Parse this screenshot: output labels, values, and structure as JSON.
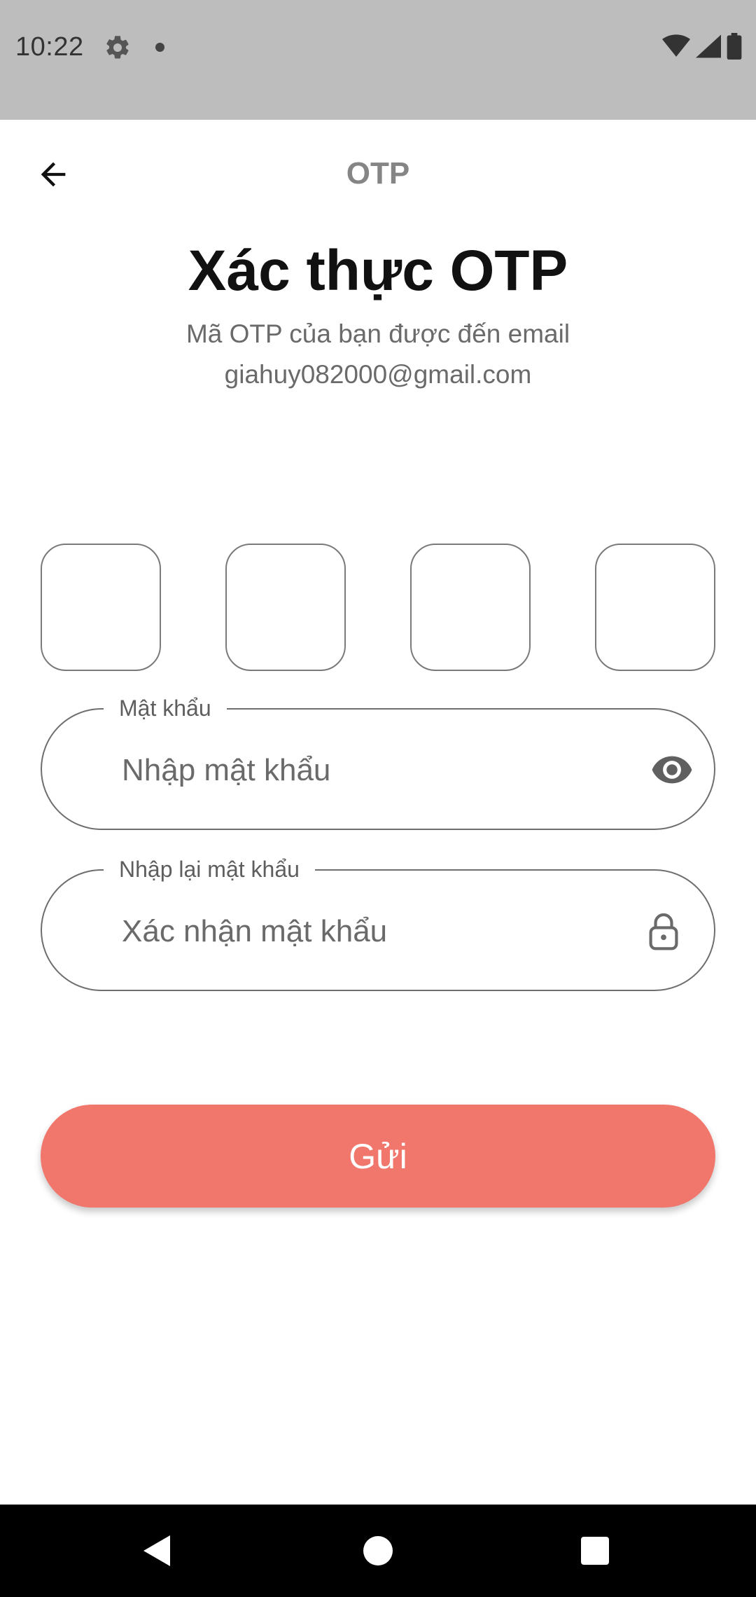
{
  "status_bar": {
    "time": "10:22",
    "icons": [
      "settings-gear-icon",
      "notification-dot-icon",
      "wifi-icon",
      "cellular-signal-icon",
      "battery-icon"
    ]
  },
  "app_bar": {
    "title": "OTP",
    "back_icon": "arrow-back-icon"
  },
  "main": {
    "heading": "Xác thực OTP",
    "subtitle_line1": "Mã OTP của bạn được đến email",
    "subtitle_line2": "giahuy082000@gmail.com"
  },
  "otp": {
    "digits": [
      "",
      "",
      "",
      ""
    ]
  },
  "password_field": {
    "label": "Mật khẩu",
    "placeholder": "Nhập mật khẩu",
    "value": "",
    "icon": "eye-icon"
  },
  "confirm_field": {
    "label": "Nhập lại mật khẩu",
    "placeholder": "Xác nhận mật khẩu",
    "value": "",
    "icon": "lock-icon"
  },
  "submit": {
    "label": "Gửi"
  },
  "colors": {
    "accent": "#f1776d",
    "status_bar": "#bdbdbd",
    "title_gray": "#858585",
    "border_gray": "#6e6e6e"
  },
  "nav_bar": {
    "icons": [
      "back-triangle-icon",
      "home-circle-icon",
      "recents-square-icon"
    ]
  }
}
